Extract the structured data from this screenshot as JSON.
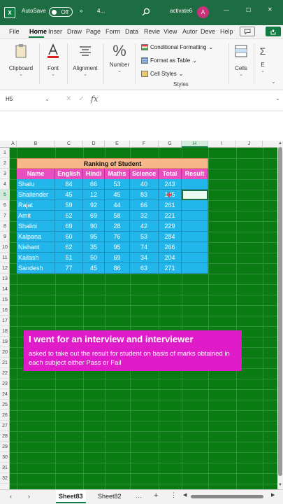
{
  "titlebar": {
    "app_logo": "X",
    "autosave_label": "AutoSave",
    "autosave_state": "Off",
    "more_label": "»",
    "quick_access_label": "4...",
    "file_name": "activate6",
    "avatar_initial": "A",
    "minimize": "—",
    "maximize": "☐",
    "close": "✕"
  },
  "ribbon_tabs": [
    "File",
    "Home",
    "Inser",
    "Draw",
    "Page",
    "Form",
    "Data",
    "Revie",
    "View",
    "Autor",
    "Deve",
    "Help"
  ],
  "ribbon_groups": {
    "clipboard": "Clipboard",
    "font": "Font",
    "alignment": "Alignment",
    "number": "Number",
    "styles_items": [
      "Conditional Formatting",
      "Format as Table",
      "Cell Styles"
    ],
    "styles_label": "Styles",
    "cells": "Cells",
    "editing": "E"
  },
  "formula_bar": {
    "name_box": "H5",
    "fx_label": "fx",
    "content": ""
  },
  "columns": [
    "A",
    "B",
    "C",
    "D",
    "E",
    "F",
    "G",
    "H",
    "I",
    "J"
  ],
  "rows": [
    "1",
    "2",
    "3",
    "4",
    "5",
    "6",
    "7",
    "8",
    "9",
    "10",
    "11",
    "12",
    "13",
    "14",
    "15",
    "16",
    "17",
    "18",
    "19",
    "20",
    "21",
    "22",
    "23",
    "24",
    "25",
    "26",
    "27",
    "28",
    "29",
    "30",
    "31",
    "32"
  ],
  "sheet": {
    "title": "Ranking of Student",
    "headers": [
      "Name",
      "English",
      "Hindi",
      "Maths",
      "Science",
      "Total",
      "Result"
    ],
    "students": [
      [
        "Shalu",
        "84",
        "66",
        "53",
        "40",
        "243"
      ],
      [
        "Shailender",
        "45",
        "12",
        "45",
        "83",
        "185"
      ],
      [
        "Rajat",
        "59",
        "92",
        "44",
        "66",
        "261"
      ],
      [
        "Amit",
        "62",
        "69",
        "58",
        "32",
        "221"
      ],
      [
        "Shalini",
        "69",
        "90",
        "28",
        "42",
        "229"
      ],
      [
        "Kalpana",
        "60",
        "95",
        "76",
        "53",
        "284"
      ],
      [
        "Nishant",
        "62",
        "35",
        "95",
        "74",
        "266"
      ],
      [
        "Kailash",
        "51",
        "50",
        "69",
        "34",
        "204"
      ],
      [
        "Sandesh",
        "77",
        "45",
        "86",
        "63",
        "271"
      ]
    ]
  },
  "banner": {
    "line1": "I went for an interview and interviewer",
    "line2": "asked to take out the result for student on basis of marks obtained in each subject either Pass or Fail"
  },
  "sheet_tabs": [
    "Sheet83",
    "Sheet82"
  ],
  "active_sheet": "Sheet83",
  "colors": {
    "excel_green": "#1e6c41",
    "sheet_background": "#0a7a12",
    "title_fill": "#f6b88a",
    "header_fill": "#e84ec0",
    "data_fill": "#22b6ea",
    "banner_fill": "#e01bc9"
  }
}
